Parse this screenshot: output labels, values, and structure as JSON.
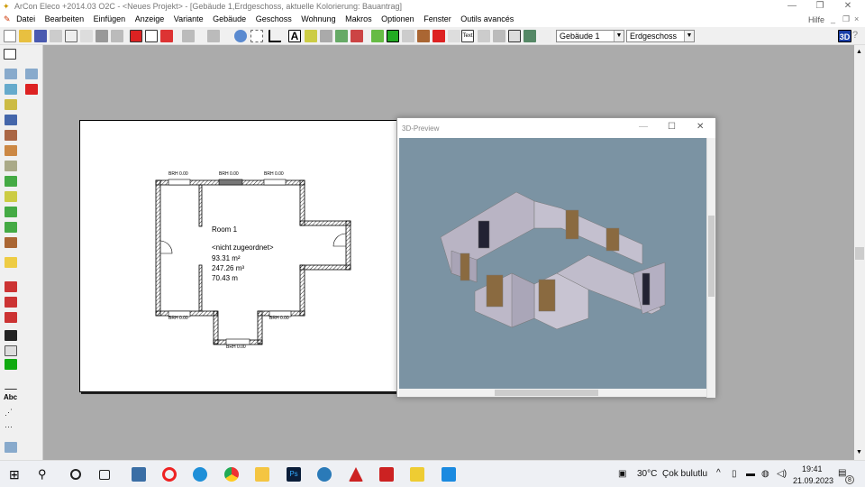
{
  "window": {
    "title": "ArCon Eleco  +2014.03  O2C - <Neues Projekt> - [Gebäude 1,Erdgeschoss, aktuelle Kolorierung: Bauantrag]",
    "minimize": "—",
    "restore": "❐",
    "close": "✕"
  },
  "menu": {
    "items": [
      "Datei",
      "Bearbeiten",
      "Einfügen",
      "Anzeige",
      "Variante",
      "Gebäude",
      "Geschoss",
      "Wohnung",
      "Makros",
      "Optionen",
      "Fenster",
      "Outils avancés"
    ],
    "help": "Hilfe",
    "mdi": [
      "_",
      "❐",
      "×"
    ]
  },
  "toolbar": {
    "building_select": "Gebäude 1",
    "floor_select": "Erdgeschoss",
    "btn_3d": "3D",
    "text_btn": "Text"
  },
  "plan": {
    "room_name": "Room 1",
    "room_type": "<nicht zugeordnet>",
    "area": "93.31 m²",
    "volume": "247.26 m³",
    "perimeter": "70.43 m",
    "window_label": "BRH 0.00"
  },
  "preview": {
    "title": "3D-Preview",
    "minimize": "—",
    "maximize": "☐",
    "close": "✕",
    "bg_color": "#7b93a3"
  },
  "taskbar": {
    "weather_temp": "30°C",
    "weather_text": "Çok bulutlu",
    "time": "19:41",
    "date": "21.09.2023",
    "notifications": "8"
  }
}
